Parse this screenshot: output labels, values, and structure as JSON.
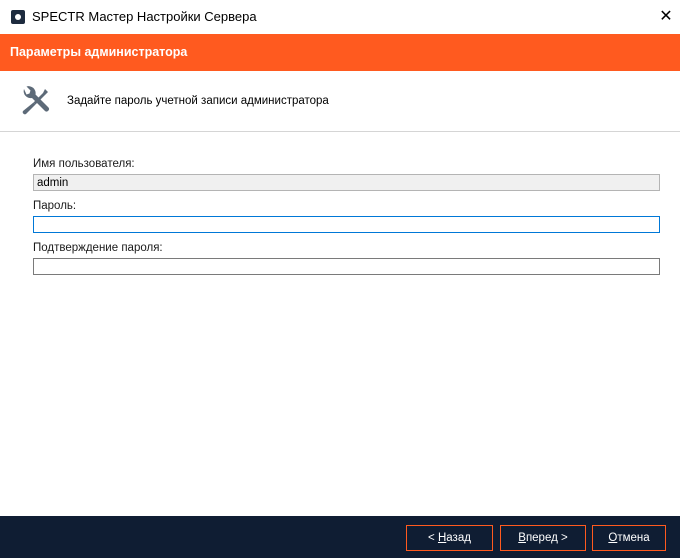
{
  "window": {
    "title": "SPECTR Мастер Настройки Сервера",
    "close_label": "✕"
  },
  "header": {
    "title": "Параметры администратора",
    "accent_color": "#ff5a1f"
  },
  "description": {
    "icon": "tools-icon",
    "text": "Задайте пароль учетной записи администратора"
  },
  "form": {
    "username_label": "Имя пользователя:",
    "username_value": "admin",
    "password_label": "Пароль:",
    "password_value": "",
    "confirm_label": "Подтверждение пароля:",
    "confirm_value": ""
  },
  "footer": {
    "background_color": "#0f1d33",
    "back_prefix": "< ",
    "back_mnemonic": "Н",
    "back_rest": "азад",
    "next_mnemonic": "В",
    "next_rest": "перед >",
    "cancel_mnemonic": "О",
    "cancel_rest": "тмена"
  }
}
